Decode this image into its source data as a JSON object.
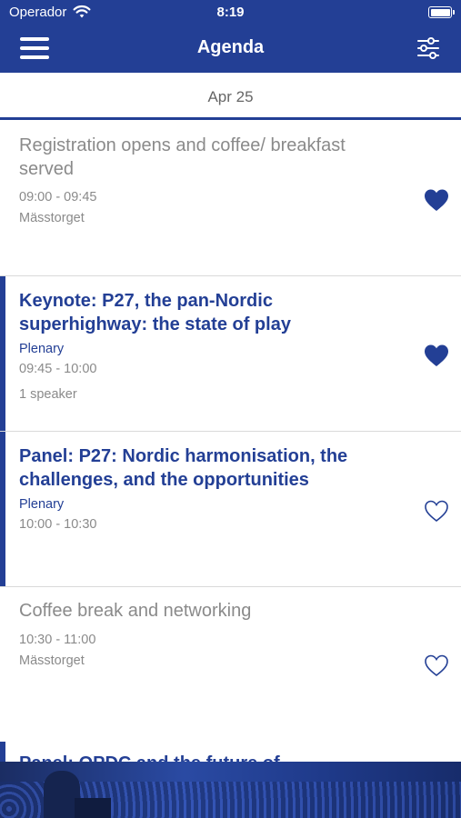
{
  "status_bar": {
    "carrier": "Operador",
    "time": "8:19"
  },
  "header": {
    "title": "Agenda"
  },
  "date": "Apr 25",
  "items": [
    {
      "title": "Registration opens and coffee/ breakfast served",
      "track": "",
      "time": "09:00 - 09:45",
      "location": "Mässtorget",
      "speakers": "",
      "favorite": true
    },
    {
      "title": "Keynote: P27, the pan-Nordic superhighway: the state of play",
      "track": "Plenary",
      "time": "09:45 - 10:00",
      "location": "",
      "speakers": "1 speaker",
      "favorite": true
    },
    {
      "title": "Panel: P27: Nordic harmonisation, the challenges, and the opportunities",
      "track": "Plenary",
      "time": "10:00 - 10:30",
      "location": "",
      "speakers": "",
      "favorite": false
    },
    {
      "title": "Coffee break and networking",
      "track": "",
      "time": "10:30 - 11:00",
      "location": "Mässtorget",
      "speakers": "",
      "favorite": false
    },
    {
      "title": "Panel: OPDC and the future of",
      "track": "",
      "time": "",
      "location": "",
      "speakers": "",
      "favorite": false
    }
  ],
  "colors": {
    "brand": "#233f95",
    "muted": "#8a8a8a",
    "divider": "#d9d9d9"
  },
  "icons": {
    "menu": "hamburger-icon",
    "filter": "sliders-icon",
    "favorite_on": "heart-filled-icon",
    "favorite_off": "heart-outline-icon"
  }
}
